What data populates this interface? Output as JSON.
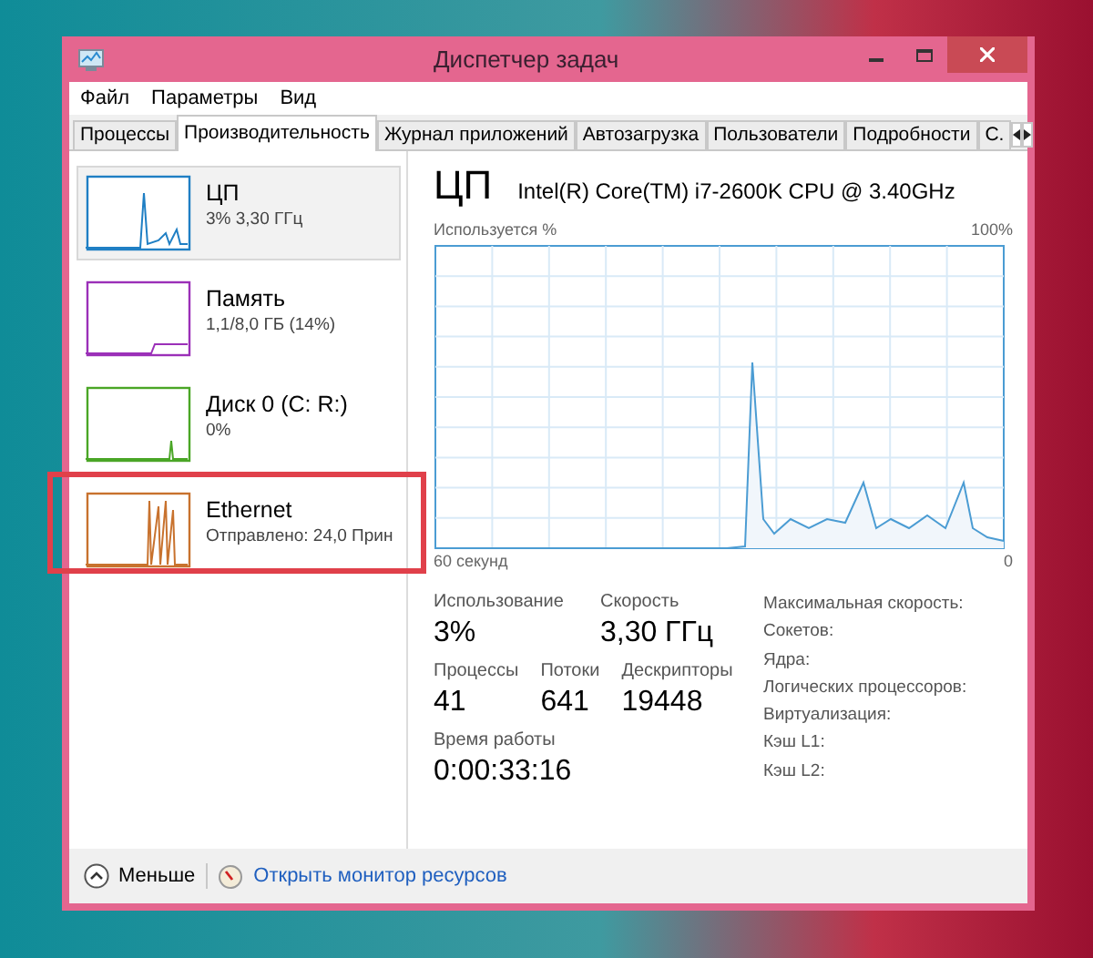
{
  "window": {
    "title": "Диспетчер задач"
  },
  "menu": [
    "Файл",
    "Параметры",
    "Вид"
  ],
  "tabs": [
    {
      "label": "Процессы",
      "selected": false
    },
    {
      "label": "Производительность",
      "selected": true
    },
    {
      "label": "Журнал приложений",
      "selected": false
    },
    {
      "label": "Автозагрузка",
      "selected": false
    },
    {
      "label": "Пользователи",
      "selected": false
    },
    {
      "label": "Подробности",
      "selected": false
    },
    {
      "label": "С.",
      "selected": false
    }
  ],
  "sidebar": {
    "items": [
      {
        "name": "ЦП",
        "detail": "3% 3,30 ГГц",
        "color": "#1f7fc4",
        "selected": true,
        "highlighted": false
      },
      {
        "name": "Память",
        "detail": "1,1/8,0 ГБ (14%)",
        "color": "#9b30b8",
        "selected": false,
        "highlighted": false
      },
      {
        "name": "Диск 0 (C: R:)",
        "detail": "0%",
        "color": "#4aa626",
        "selected": false,
        "highlighted": false
      },
      {
        "name": "Ethernet",
        "detail": "Отправлено: 24,0 Прин",
        "color": "#c8722e",
        "selected": false,
        "highlighted": true
      }
    ]
  },
  "detail": {
    "title": "ЦП",
    "model": "Intel(R) Core(TM) i7-2600K CPU @ 3.40GHz",
    "graph_label": "Используется %",
    "graph_max": "100%",
    "graph_start": "60 секунд",
    "graph_end": "0",
    "stats_row1": [
      {
        "label": "Использование",
        "value": "3%"
      },
      {
        "label": "Скорость",
        "value": "3,30 ГГц"
      }
    ],
    "stats_row2": [
      {
        "label": "Процессы",
        "value": "41"
      },
      {
        "label": "Потоки",
        "value": "641"
      },
      {
        "label": "Дескрипторы",
        "value": "19448"
      }
    ],
    "uptime": {
      "label": "Время работы",
      "value": "0:00:33:16"
    },
    "properties": [
      "Максимальная скорость:",
      "Сокетов:",
      "Ядра:",
      "Логических процессоров:",
      "Виртуализация:",
      "Кэш L1:",
      "Кэш L2:"
    ]
  },
  "footer": {
    "less": "Меньше",
    "link": "Открыть монитор ресурсов"
  }
}
